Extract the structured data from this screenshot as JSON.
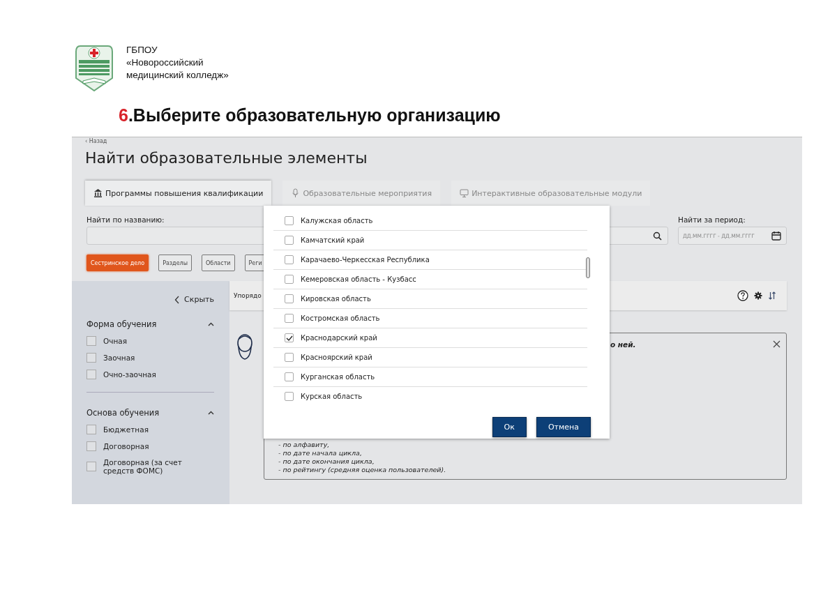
{
  "header": {
    "organization_lines": [
      "ГБПОУ",
      "«Новороссийский",
      "медицинский колледж»"
    ]
  },
  "heading": {
    "number": "6",
    "text": ".Выберите образовательную организацию"
  },
  "app": {
    "back_link": "‹ Назад",
    "title": "Найти образовательные элементы",
    "tabs": [
      {
        "label": "Программы повышения квалификации",
        "selected": true
      },
      {
        "label": "Образовательные мероприятия",
        "selected": false
      },
      {
        "label": "Интерактивные образовательные модули",
        "selected": false
      }
    ],
    "search": {
      "label": "Найти по названию:"
    },
    "period": {
      "label": "Найти за период:",
      "placeholder": "ДД.ММ.ГГГГ - ДД.ММ.ГГГГ"
    },
    "chips": [
      {
        "label": "Сестринское дело",
        "selected": true
      },
      {
        "label": "Разделы",
        "selected": false
      },
      {
        "label": "Области",
        "selected": false
      },
      {
        "label": "Реги",
        "selected": false
      }
    ],
    "sidebar": {
      "hide_label": "Скрыть",
      "groups": [
        {
          "title": "Форма обучения",
          "expanded": true,
          "options": [
            {
              "label": "Очная",
              "checked": false
            },
            {
              "label": "Заочная",
              "checked": false
            },
            {
              "label": "Очно-заочная",
              "checked": false
            }
          ]
        },
        {
          "title": "Основа обучения",
          "expanded": true,
          "options": [
            {
              "label": "Бюджетная",
              "checked": false
            },
            {
              "label": "Договорная",
              "checked": false
            },
            {
              "label": "Договорная (за счет средств ФОМС)",
              "checked": false
            }
          ]
        }
      ]
    },
    "sort_label": "Упорядо",
    "info": {
      "tail_text": "о ней.",
      "lines": [
        "- по алфавиту,",
        "- по дате начала цикла,",
        "- по дате окончания цикла,",
        "- по рейтингу (средняя оценка пользователей)."
      ]
    },
    "modal": {
      "regions": [
        {
          "label": "Калужская область",
          "checked": false
        },
        {
          "label": "Камчатский край",
          "checked": false
        },
        {
          "label": "Карачаево-Черкесская Республика",
          "checked": false
        },
        {
          "label": "Кемеровская область - Кузбасс",
          "checked": false
        },
        {
          "label": "Кировская область",
          "checked": false
        },
        {
          "label": "Костромская область",
          "checked": false
        },
        {
          "label": "Краснодарский край",
          "checked": true
        },
        {
          "label": "Красноярский край",
          "checked": false
        },
        {
          "label": "Курганская область",
          "checked": false
        },
        {
          "label": "Курская область",
          "checked": false
        }
      ],
      "buttons": [
        "Ок",
        "Отмена"
      ]
    }
  }
}
